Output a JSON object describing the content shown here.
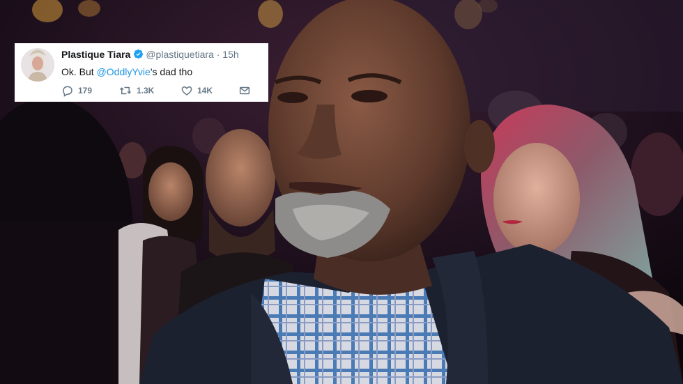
{
  "tweet": {
    "name": "Plastique Tiara",
    "handle": "@plastiquetiara",
    "separator": "·",
    "time": "15h",
    "text_before": "Ok. But ",
    "mention": "@OddlyYvie",
    "text_after": "'s dad tho",
    "replies": "179",
    "retweets": "1.3K",
    "likes": "14K",
    "verified": true
  },
  "colors": {
    "verified_blue": "#1da1f2",
    "mention_blue": "#1b95e0",
    "muted_gray": "#657786"
  },
  "icons": [
    "avatar-photo",
    "verified-badge-icon",
    "reply-icon",
    "retweet-icon",
    "like-icon",
    "direct-message-icon"
  ]
}
